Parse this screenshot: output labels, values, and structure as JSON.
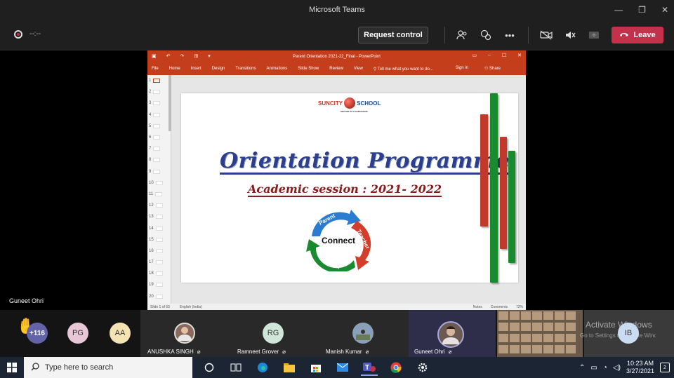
{
  "window": {
    "title": "Microsoft Teams",
    "controls": [
      "—",
      "❐",
      "✕"
    ]
  },
  "toolbar": {
    "timer": "--:--",
    "request_control_label": "Request control",
    "leave_label": "Leave"
  },
  "presenter": {
    "name": "Guneet Ohri"
  },
  "powerpoint": {
    "title": "Parent Orientation 2021-22_Final - PowerPoint",
    "tabs": [
      "File",
      "Home",
      "Insert",
      "Design",
      "Transitions",
      "Animations",
      "Slide Show",
      "Review",
      "View"
    ],
    "tell_me": "Tell me what you want to do...",
    "sign_in": "Sign in",
    "share": "Share",
    "thumbnail_numbers": [
      "1",
      "2",
      "3",
      "4",
      "5",
      "6",
      "7",
      "8",
      "9",
      "10",
      "11",
      "12",
      "13",
      "14",
      "15",
      "16",
      "17",
      "18",
      "19",
      "20"
    ],
    "status_slide": "Slide 1 of 63",
    "status_lang": "English (India)",
    "status_notes": "Notes",
    "status_comments": "Comments",
    "zoom": "72%"
  },
  "slide": {
    "school_left": "SUNCITY",
    "school_right": "SCHOOL",
    "school_sub": "SECTOR 37 D GURUGRAM",
    "title": "Orientation Programme",
    "subtitle": "Academic session : 2021- 2022",
    "cycle_center": "Connect",
    "cycle_labels": [
      "Parent",
      "Teacher",
      "Student"
    ]
  },
  "gallery": {
    "raised_hand_count": "+116",
    "initials": [
      {
        "initials": "PG",
        "color": "#e9c6d6"
      },
      {
        "initials": "AA",
        "color": "#f6e3b4"
      }
    ],
    "participants": [
      {
        "name": "ANUSHKA SINGH",
        "type": "photo"
      },
      {
        "name": "Ramneet Grover",
        "type": "initials",
        "initials": "RG",
        "color": "#cfe6d8"
      },
      {
        "name": "Manish Kumar",
        "type": "photo"
      },
      {
        "name": "Guneet Ohri",
        "type": "photo"
      }
    ],
    "overflow_tile_text": "Activate Windows",
    "overflow_tile_sub": "Go to Settings to activate Windows.",
    "last_initials": {
      "initials": "IB",
      "color": "#c9dcf2"
    }
  },
  "taskbar": {
    "search_placeholder": "Type here to search",
    "time": "10:23 AM",
    "date": "3/27/2021",
    "notification_count": "2"
  },
  "colors": {
    "leave": "#c4314b",
    "ppt_accent": "#c43e1c",
    "teams_purple": "#6264a7"
  }
}
